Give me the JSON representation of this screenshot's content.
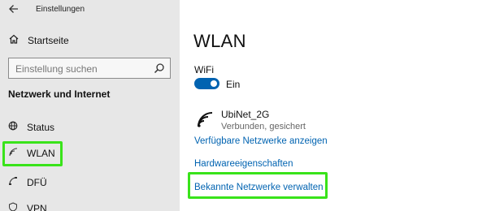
{
  "window": {
    "title": "Einstellungen",
    "back_icon": "back-arrow-icon"
  },
  "sidebar": {
    "home": {
      "label": "Startseite",
      "icon": "home-icon"
    },
    "search": {
      "placeholder": "Einstellung suchen",
      "icon": "search-icon"
    },
    "section_heading": "Netzwerk und Internet",
    "items": [
      {
        "label": "Status",
        "icon": "globe-icon"
      },
      {
        "label": "WLAN",
        "icon": "wifi-icon",
        "highlighted": true
      },
      {
        "label": "DFÜ",
        "icon": "dialup-icon"
      },
      {
        "label": "VPN",
        "icon": "vpn-icon"
      }
    ]
  },
  "main": {
    "title": "WLAN",
    "wifi_label": "WiFi",
    "toggle": {
      "state_label": "Ein",
      "on": true,
      "color": "#0063b1"
    },
    "network": {
      "name": "UbiNet_2G",
      "status": "Verbunden, gesichert",
      "icon": "wifi-signal-icon"
    },
    "links": {
      "available": "Verfügbare Netzwerke anzeigen",
      "hardware": "Hardwareeigenschaften",
      "known": "Bekannte Netzwerke verwalten"
    }
  },
  "colors": {
    "accent": "#0063b1",
    "highlight": "#39e31a",
    "sidebar_bg": "#e7e7e7"
  }
}
